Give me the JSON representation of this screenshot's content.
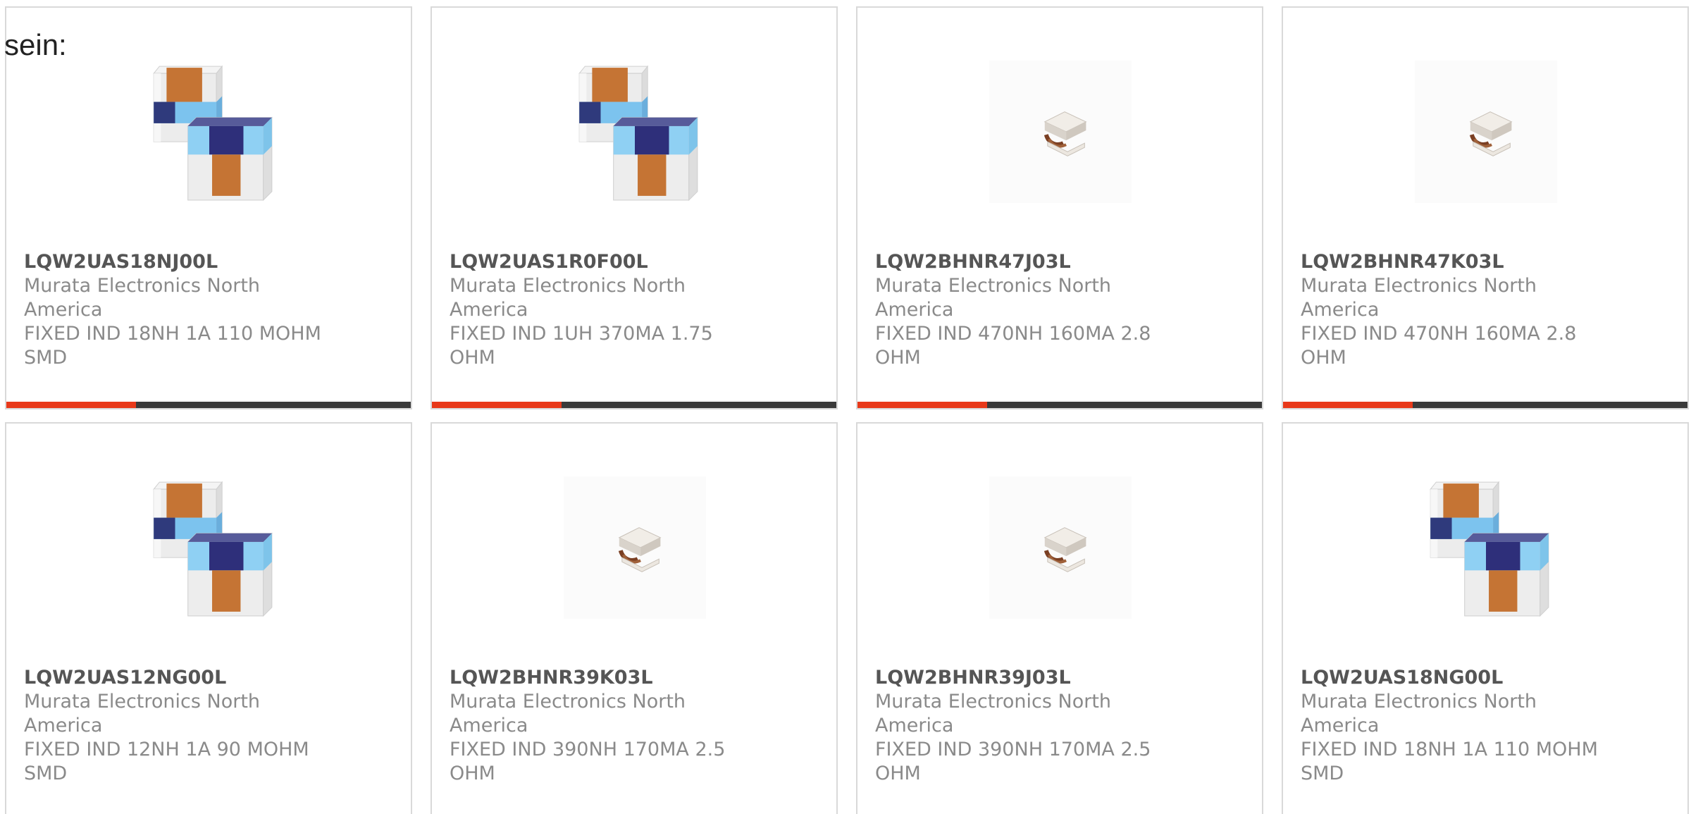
{
  "lead_text": "sein:",
  "colors": {
    "accent": "#e8391a",
    "track": "#3a3a3a",
    "border": "#d9d9d9",
    "part_number": "#555555",
    "body_text": "#8a8a8a"
  },
  "products": [
    {
      "part_number": "LQW2UAS18NJ00L",
      "manufacturer": "Murata Electronics North America",
      "description": "FIXED IND 18NH 1A 110 MOHM SMD",
      "image_icon": "chip-inductor-pair-icon",
      "carousel_progress": 0.32
    },
    {
      "part_number": "LQW2UAS1R0F00L",
      "manufacturer": "Murata Electronics North America",
      "description": "FIXED IND 1UH 370MA 1.75 OHM",
      "image_icon": "chip-inductor-pair-icon",
      "carousel_progress": 0.32
    },
    {
      "part_number": "LQW2BHNR47J03L",
      "manufacturer": "Murata Electronics North America",
      "description": "FIXED IND 470NH 160MA 2.8 OHM",
      "image_icon": "wirewound-inductor-icon",
      "carousel_progress": 0.32
    },
    {
      "part_number": "LQW2BHNR47K03L",
      "manufacturer": "Murata Electronics North America",
      "description": "FIXED IND 470NH 160MA 2.8 OHM",
      "image_icon": "wirewound-inductor-icon",
      "carousel_progress": 0.32
    },
    {
      "part_number": "LQW2UAS12NG00L",
      "manufacturer": "Murata Electronics North America",
      "description": "FIXED IND 12NH 1A 90 MOHM SMD",
      "image_icon": "chip-inductor-pair-icon"
    },
    {
      "part_number": "LQW2BHNR39K03L",
      "manufacturer": "Murata Electronics North America",
      "description": "FIXED IND 390NH 170MA 2.5 OHM",
      "image_icon": "wirewound-inductor-icon"
    },
    {
      "part_number": "LQW2BHNR39J03L",
      "manufacturer": "Murata Electronics North America",
      "description": "FIXED IND 390NH 170MA 2.5 OHM",
      "image_icon": "wirewound-inductor-icon"
    },
    {
      "part_number": "LQW2UAS18NG00L",
      "manufacturer": "Murata Electronics North America",
      "description": "FIXED IND 18NH 1A 110 MOHM SMD",
      "image_icon": "chip-inductor-pair-icon"
    }
  ]
}
